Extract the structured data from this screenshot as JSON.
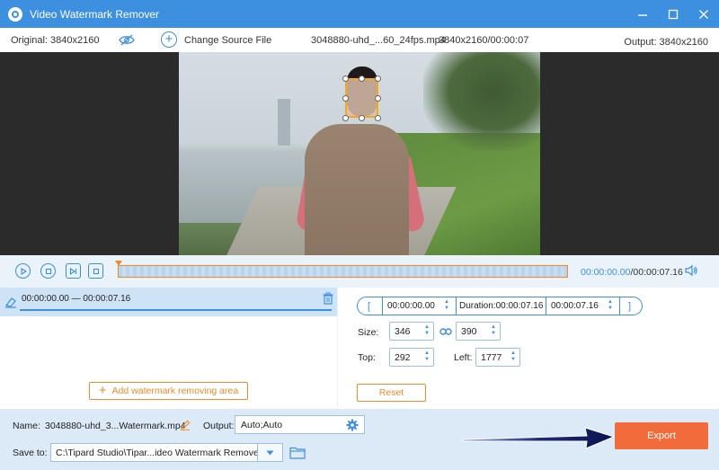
{
  "window": {
    "title": "Video Watermark Remover",
    "controls": [
      "minimize",
      "maximize",
      "close"
    ]
  },
  "infobar": {
    "original": "Original: 3840x2160",
    "change_source": "Change Source File",
    "file_name": "3048880-uhd_...60_24fps.mp4",
    "file_res": "3840x2160/00:00:07",
    "output": "Output: 3840x2160"
  },
  "playback": {
    "current_time": "00:00:00.00",
    "total_time": "/00:00:07.16"
  },
  "clip": {
    "range": "00:00:00.00 — 00:00:07.16"
  },
  "left_panel": {
    "add_area_label": "Add watermark removing area"
  },
  "right_panel": {
    "start_bracket": "[",
    "start_time": "00:00:00.00",
    "duration": "Duration:00:00:07.16",
    "end_time": "00:00:07.16",
    "end_bracket": "]",
    "size_label": "Size:",
    "width": "346",
    "height": "390",
    "top_label": "Top:",
    "top_value": "292",
    "left_label": "Left:",
    "left_value": "1777",
    "reset_label": "Reset"
  },
  "bottom": {
    "name_label": "Name:",
    "name_value": "3048880-uhd_3...Watermark.mp4",
    "output_label": "Output:",
    "output_value": "Auto;Auto",
    "saveto_label": "Save to:",
    "saveto_value": "C:\\Tipard Studio\\Tipar...ideo Watermark Remover",
    "export_label": "Export"
  },
  "colors": {
    "accent": "#3d8fe0",
    "orange": "#f08a2c",
    "export": "#f26b3a",
    "titlebar": "#3d8fe0"
  }
}
